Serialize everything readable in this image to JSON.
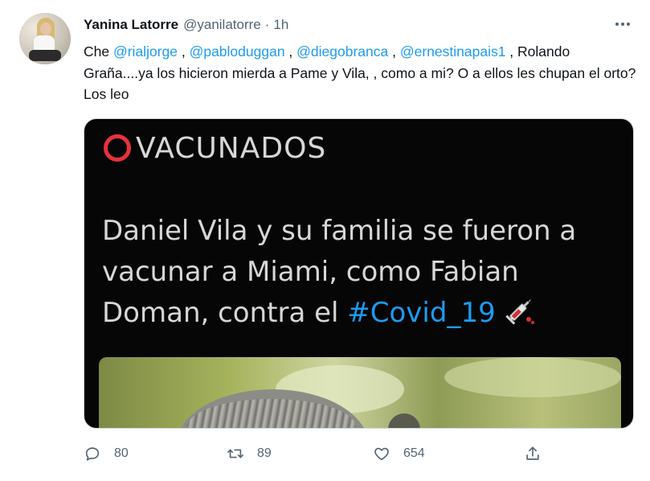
{
  "tweet": {
    "author_name": "Yanina Latorre",
    "author_handle": "@yanilatorre",
    "separator": "·",
    "time": "1h",
    "text": {
      "intro": "Che ",
      "mention1": "@rialjorge",
      "sep1": " , ",
      "mention2": "@pabloduggan",
      "sep2": " , ",
      "mention3": "@diegobranca",
      "sep3": " , ",
      "mention4": "@ernestinapais1",
      "rest": " , Rolando Graña....ya los hicieron mierda a Pame y Vila, , como a mi? O a ellos les chupan el orto? Los leo"
    },
    "media": {
      "title": "VACUNADOS",
      "headline_text": "Daniel Vila y su familia se fueron a vacunar a Miami, como Fabian Doman, contra el ",
      "hashtag": "#Covid_19"
    },
    "actions": {
      "replies": "80",
      "retweets": "89",
      "likes": "654"
    }
  },
  "colors": {
    "accent": "#1d9bf0",
    "text": "#0f1419",
    "muted": "#536471",
    "vac_red": "#e8323a"
  },
  "icons": [
    "more-icon",
    "reply-icon",
    "retweet-icon",
    "like-icon",
    "share-icon",
    "syringe-icon"
  ]
}
